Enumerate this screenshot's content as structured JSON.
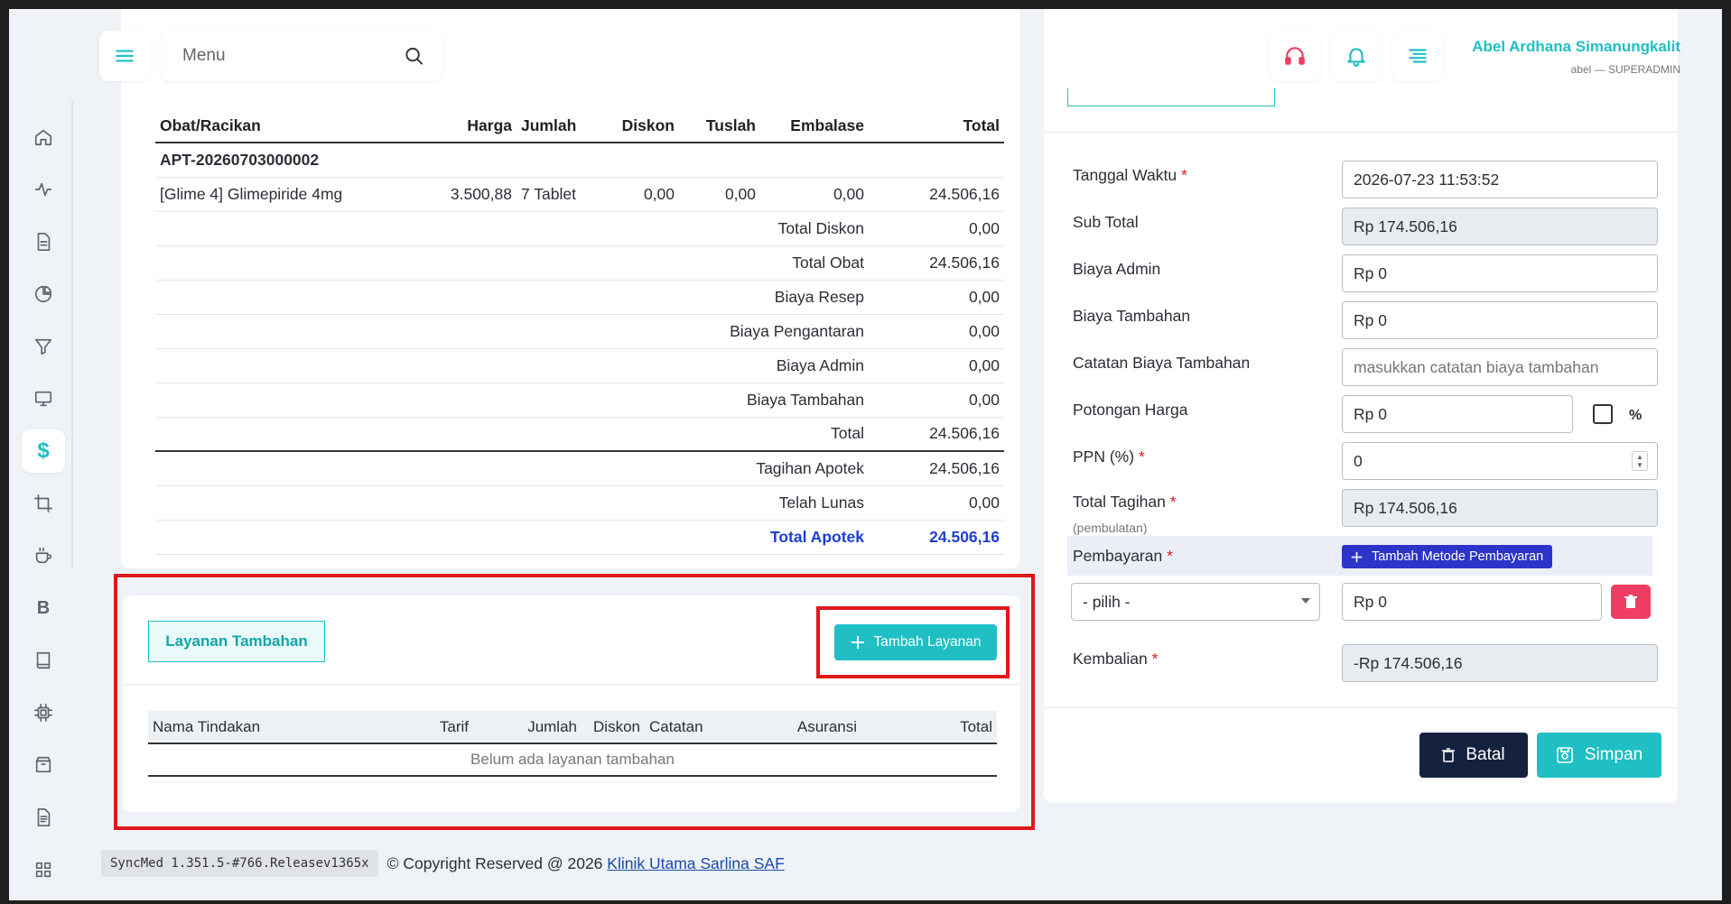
{
  "search": {
    "placeholder": "Menu"
  },
  "user": {
    "name": "Abel Ardhana Simanungkalit",
    "role": "abel — SUPERADMIN"
  },
  "sidebar": {
    "active_symbol": "$",
    "b_symbol": "B"
  },
  "obat": {
    "headers": {
      "obat": "Obat/Racikan",
      "harga": "Harga",
      "jumlah": "Jumlah",
      "diskon": "Diskon",
      "tuslah": "Tuslah",
      "embalase": "Embalase",
      "total": "Total"
    },
    "apt_code": "APT-20260703000002",
    "item": {
      "name": "[Glime 4] Glimepiride 4mg",
      "harga": "3.500,88",
      "jumlah": "7 Tablet",
      "diskon": "0,00",
      "tuslah": "0,00",
      "embalase": "0,00",
      "total": "24.506,16"
    },
    "summary": [
      {
        "label": "Total Diskon",
        "value": "0,00"
      },
      {
        "label": "Total Obat",
        "value": "24.506,16"
      },
      {
        "label": "Biaya Resep",
        "value": "0,00"
      },
      {
        "label": "Biaya Pengantaran",
        "value": "0,00"
      },
      {
        "label": "Biaya Admin",
        "value": "0,00"
      },
      {
        "label": "Biaya Tambahan",
        "value": "0,00"
      },
      {
        "label": "Total",
        "value": "24.506,16"
      },
      {
        "label": "Tagihan Apotek",
        "value": "24.506,16"
      },
      {
        "label": "Telah Lunas",
        "value": "0,00"
      },
      {
        "label": "Total Apotek",
        "value": "24.506,16"
      }
    ]
  },
  "layanan": {
    "tab_label": "Layanan Tambahan",
    "add_button": "Tambah Layanan",
    "headers": {
      "nama": "Nama Tindakan",
      "tarif": "Tarif",
      "jumlah": "Jumlah",
      "diskon": "Diskon",
      "catatan": "Catatan",
      "asuransi": "Asuransi",
      "total": "Total"
    },
    "empty": "Belum ada layanan tambahan"
  },
  "footer": {
    "version": "SyncMed 1.351.5-#766.Releasev1365x",
    "copyright": "© Copyright Reserved @ 2026",
    "clinic": "Klinik Utama Sarlina SAF"
  },
  "form": {
    "tanggal_label": "Tanggal Waktu",
    "tanggal_value": "2026-07-23 11:53:52",
    "subtotal_label": "Sub Total",
    "subtotal_value": "Rp 174.506,16",
    "admin_label": "Biaya Admin",
    "admin_value": "Rp 0",
    "tambahan_label": "Biaya Tambahan",
    "tambahan_value": "Rp 0",
    "catatan_label": "Catatan Biaya Tambahan",
    "catatan_placeholder": "masukkan catatan biaya tambahan",
    "potongan_label": "Potongan Harga",
    "potongan_value": "Rp 0",
    "percent_symbol": "%",
    "ppn_label": "PPN (%)",
    "ppn_value": "0",
    "total_tagihan_label": "Total Tagihan",
    "total_tagihan_sub": "(pembulatan)",
    "total_tagihan_value": "Rp 174.506,16",
    "pembayaran_label": "Pembayaran",
    "tambah_metode": "Tambah Metode Pembayaran",
    "pilih_value": "- pilih -",
    "pembayaran_value": "Rp 0",
    "kembalian_label": "Kembalian",
    "kembalian_value": "-Rp 174.506,16",
    "required_mark": "*"
  },
  "actions": {
    "batal": "Batal",
    "simpan": "Simpan"
  },
  "colors": {
    "teal": "#1fbfc4",
    "navy": "#15223f",
    "blue": "#2c34c9",
    "red_highlight": "#e0181c",
    "danger": "#ef3d63"
  }
}
